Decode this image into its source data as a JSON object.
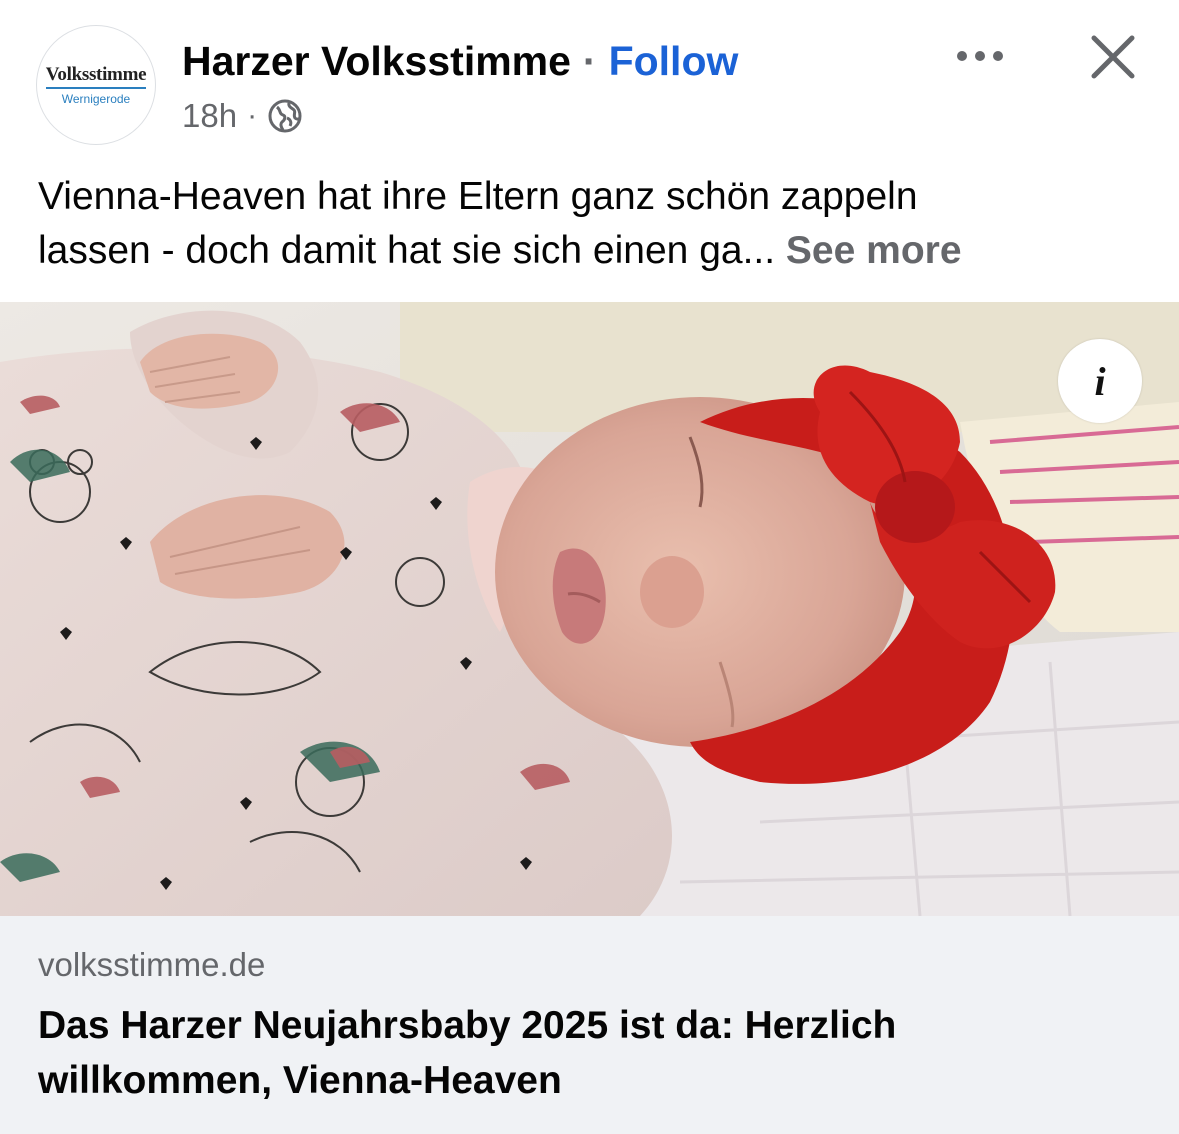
{
  "post": {
    "page_name": "Harzer Volksstimme",
    "separator": "·",
    "follow_label": "Follow",
    "timestamp": "18h",
    "meta_separator": "·",
    "privacy_icon": "globe-icon",
    "avatar": {
      "logo_main": "Volksstimme",
      "logo_sub": "Wernigerode"
    },
    "text_line_1": "Vienna-Heaven hat ihre Eltern ganz schön zappeln",
    "text_line_2": "lassen - doch damit hat sie sich einen ga...",
    "see_more_label": "See more",
    "more_icon": "more-horizontal-icon",
    "close_icon": "close-icon"
  },
  "media": {
    "info_label": "i"
  },
  "link_preview": {
    "domain": "volksstimme.de",
    "title_line_1": "Das Harzer Neujahrsbaby 2025 ist da: Herzlich",
    "title_line_2": "willkommen, Vienna-Heaven"
  },
  "colors": {
    "follow": "#1b62d6",
    "secondary_text": "#65676b",
    "card_background": "#f0f2f5",
    "headband_red": "#c81d1a"
  }
}
